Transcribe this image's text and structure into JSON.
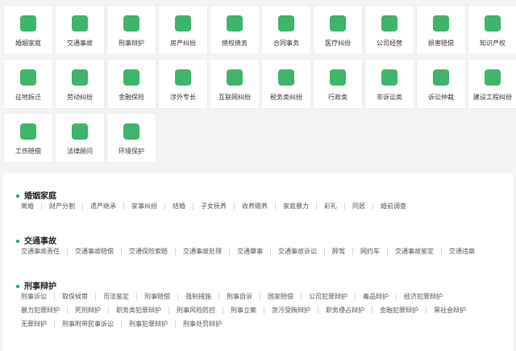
{
  "categories": [
    {
      "label": "婚姻家庭",
      "icon": "heart-icon"
    },
    {
      "label": "交通事故",
      "icon": "car-icon"
    },
    {
      "label": "刑事辩护",
      "icon": "gavel-icon"
    },
    {
      "label": "房产纠纷",
      "icon": "house-icon"
    },
    {
      "label": "债权债务",
      "icon": "money-bag-icon"
    },
    {
      "label": "合同事务",
      "icon": "stamp-icon"
    },
    {
      "label": "医疗纠纷",
      "icon": "medical-icon"
    },
    {
      "label": "公司经营",
      "icon": "briefcase-icon"
    },
    {
      "label": "损害赔偿",
      "icon": "hands-icon"
    },
    {
      "label": "知识产权",
      "icon": "book-icon"
    },
    {
      "label": "征地拆迁",
      "icon": "shield-icon"
    },
    {
      "label": "劳动纠纷",
      "icon": "worker-icon"
    },
    {
      "label": "金融保险",
      "icon": "finance-icon"
    },
    {
      "label": "涉外专长",
      "icon": "plane-icon"
    },
    {
      "label": "互联网纠纷",
      "icon": "internet-icon"
    },
    {
      "label": "税务类纠纷",
      "icon": "tax-icon"
    },
    {
      "label": "行政类",
      "icon": "document-icon"
    },
    {
      "label": "非诉讼类",
      "icon": "folder-icon"
    },
    {
      "label": "诉讼仲裁",
      "icon": "gavel-icon"
    },
    {
      "label": "建设工程纠纷",
      "icon": "monitor-icon"
    },
    {
      "label": "工伤赔偿",
      "icon": "injury-icon"
    },
    {
      "label": "法律顾问",
      "icon": "advisor-icon"
    },
    {
      "label": "环境保护",
      "icon": "recycle-icon"
    }
  ],
  "sections": [
    {
      "title": "婚姻家庭",
      "rows": [
        [
          "离婚",
          "财产分割",
          "遗产继承",
          "家事纠纷",
          "结婚",
          "子女抚养",
          "收养赡养",
          "家庭暴力",
          "彩礼",
          "同居",
          "婚前调查"
        ]
      ]
    },
    {
      "title": "交通事故",
      "rows": [
        [
          "交通事故责任",
          "交通事故赔偿",
          "交通保险索赔",
          "交通事故处理",
          "交通肇事",
          "交通事故诉讼",
          "醉驾",
          "网约车",
          "交通事故鉴定",
          "交通违章"
        ]
      ]
    },
    {
      "title": "刑事辩护",
      "rows": [
        [
          "刑事诉讼",
          "取保候审",
          "司法鉴定",
          "刑事赔偿",
          "强制措施",
          "刑事自诉",
          "国家赔偿",
          "公司犯罪辩护",
          "毒品辩护",
          "经济犯罪辩护"
        ],
        [
          "暴力犯罪辩护",
          "死刑辩护",
          "职务类犯罪辩护",
          "刑事风险防控",
          "刑事立案",
          "贪污受贿辩护",
          "职务侵占辩护",
          "金融犯罪辩护",
          "黑社会辩护"
        ],
        [
          "无罪辩护",
          "刑事附带民事诉讼",
          "刑事犯罪辩护",
          "刑事处罚辩护"
        ]
      ]
    }
  ],
  "colors": {
    "accent": "#2aa35a",
    "icon_green": "#3fb56b"
  }
}
